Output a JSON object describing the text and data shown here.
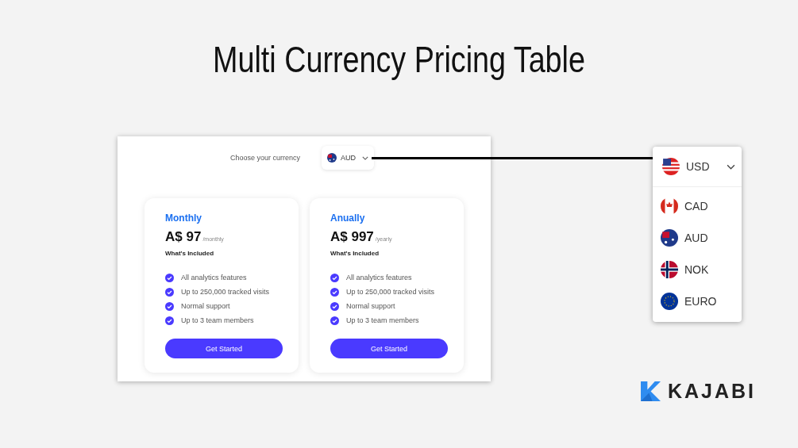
{
  "title": "Multi Currency Pricing Table",
  "pricing": {
    "currency_label": "Choose your currency",
    "currency_select": {
      "kind": "au",
      "value": "AUD"
    },
    "plans": [
      {
        "name": "Monthly",
        "price": "A$ 97",
        "period": "/monthly",
        "included_heading": "What's Included",
        "features": [
          "All analytics features",
          "Up to 250,000 tracked visits",
          "Normal support",
          "Up to 3 team members"
        ],
        "button": "Get Started"
      },
      {
        "name": "Anually",
        "price": "A$ 997",
        "period": "/yearly",
        "included_heading": "What's Included",
        "features": [
          "All analytics features",
          "Up to 250,000 tracked visits",
          "Normal support",
          "Up to 3 team members"
        ],
        "button": "Get Started"
      }
    ]
  },
  "dropdown": {
    "selected": {
      "kind": "us",
      "value": "USD"
    },
    "options": [
      {
        "kind": "ca",
        "label": "CAD"
      },
      {
        "kind": "au",
        "label": "AUD"
      },
      {
        "kind": "no",
        "label": "NOK"
      },
      {
        "kind": "eu",
        "label": "EURO"
      }
    ]
  },
  "logo": {
    "text": "KAJABI"
  }
}
